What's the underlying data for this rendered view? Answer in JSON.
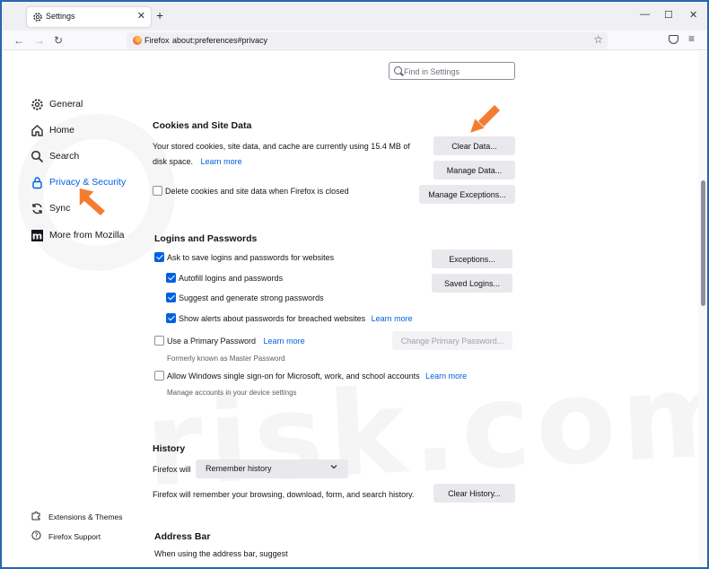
{
  "window": {
    "tab_title": "Settings",
    "tab_close": "✕",
    "new_tab": "+",
    "minimize": "—",
    "maximize": "☐",
    "close": "✕"
  },
  "nav": {
    "back": "←",
    "forward": "→",
    "reload": "↻",
    "identity_chip": "Firefox",
    "url": "about:preferences#privacy",
    "bookmark_star": "☆",
    "menu": "≡"
  },
  "search": {
    "placeholder": "Find in Settings"
  },
  "sidebar": {
    "items": [
      {
        "label": "General",
        "icon": "gear-icon"
      },
      {
        "label": "Home",
        "icon": "home-icon"
      },
      {
        "label": "Search",
        "icon": "search-icon"
      },
      {
        "label": "Privacy & Security",
        "icon": "lock-icon",
        "active": true
      },
      {
        "label": "Sync",
        "icon": "sync-icon"
      },
      {
        "label": "More from Mozilla",
        "icon": "mozilla-icon"
      }
    ],
    "footer": [
      {
        "label": "Extensions & Themes",
        "icon": "puzzle-icon"
      },
      {
        "label": "Firefox Support",
        "icon": "help-icon"
      }
    ]
  },
  "cookies": {
    "heading": "Cookies and Site Data",
    "desc_line1": "Your stored cookies, site data, and cache are currently using 15.4 MB of",
    "desc_line2": "disk space.",
    "learn_more": "Learn more",
    "delete_on_close": "Delete cookies and site data when Firefox is closed",
    "clear_data": "Clear Data...",
    "manage_data": "Manage Data...",
    "manage_exceptions": "Manage Exceptions..."
  },
  "logins": {
    "heading": "Logins and Passwords",
    "ask_save": "Ask to save logins and passwords for websites",
    "autofill": "Autofill logins and passwords",
    "suggest": "Suggest and generate strong passwords",
    "alerts": "Show alerts about passwords for breached websites",
    "alerts_learn_more": "Learn more",
    "primary_password": "Use a Primary Password",
    "primary_learn_more": "Learn more",
    "formerly": "Formerly known as Master Password",
    "windows_sso": "Allow Windows single sign-on for Microsoft, work, and school accounts",
    "sso_learn_more": "Learn more",
    "manage_accounts": "Manage accounts in your device settings",
    "exceptions": "Exceptions...",
    "saved_logins": "Saved Logins...",
    "change_primary": "Change Primary Password..."
  },
  "history": {
    "heading": "History",
    "firefox_will": "Firefox will",
    "mode": "Remember history",
    "desc": "Firefox will remember your browsing, download, form, and search history.",
    "clear_history": "Clear History..."
  },
  "address_bar": {
    "heading": "Address Bar",
    "desc": "When using the address bar, suggest"
  },
  "watermark": {
    "text": "risk.com"
  },
  "colors": {
    "accent": "#0061e0",
    "arrow": "#f47c30"
  }
}
